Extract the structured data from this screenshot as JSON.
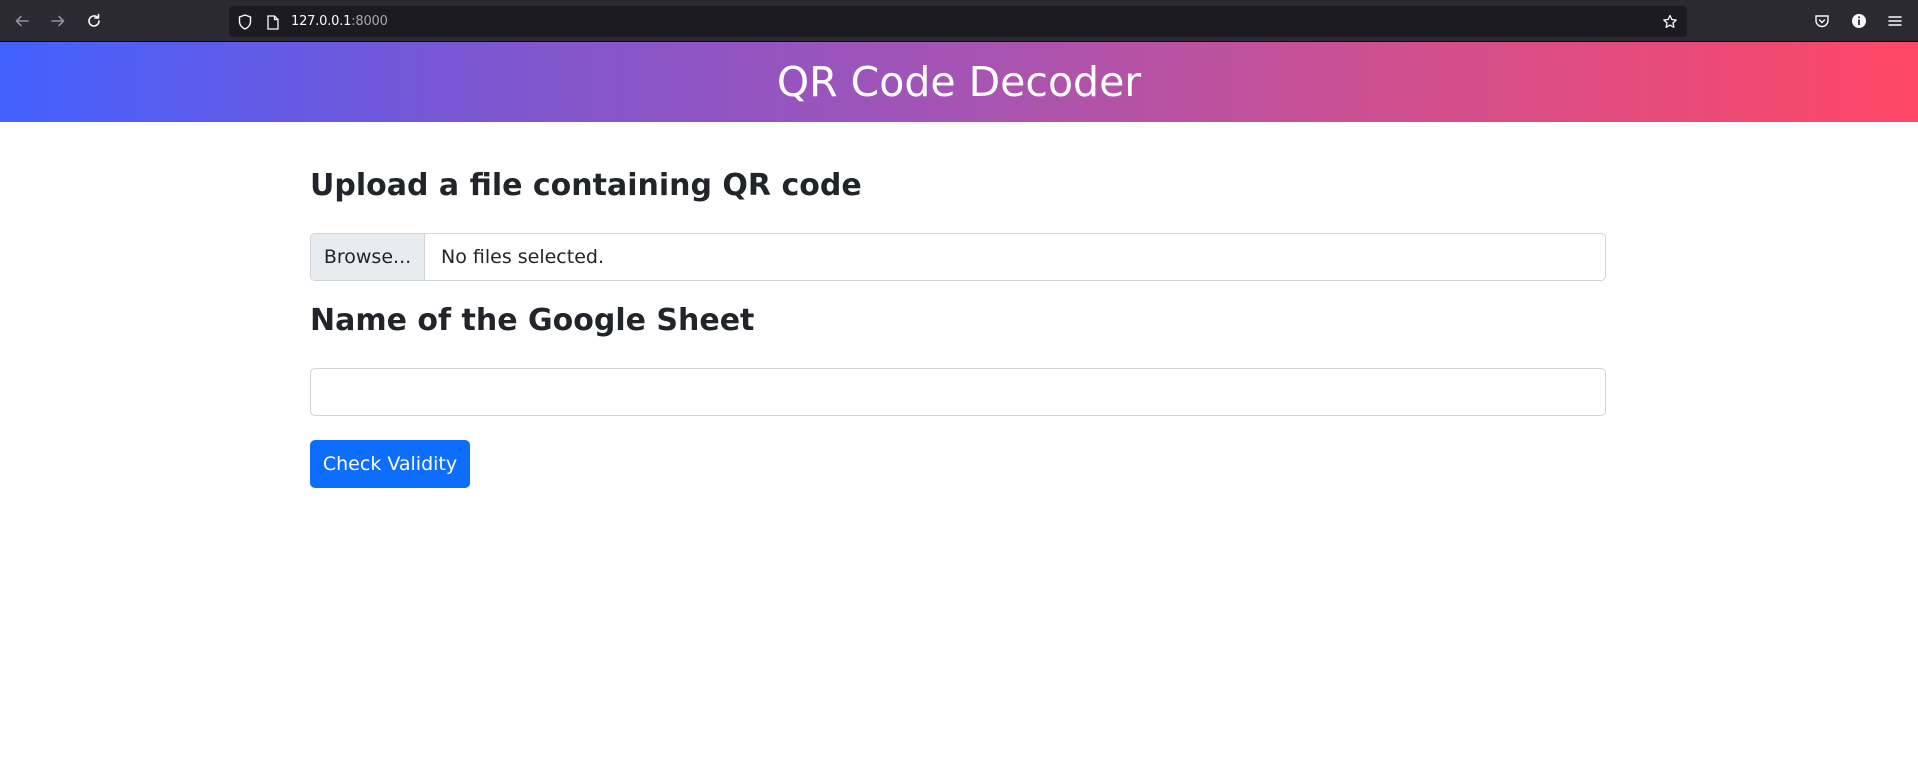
{
  "browser": {
    "url_host": "127.0.0.1",
    "url_port": ":8000",
    "icons": [
      "back-icon",
      "forward-icon",
      "reload-icon",
      "shield-icon",
      "page-icon",
      "star-icon",
      "pocket-icon",
      "info-icon",
      "menu-icon"
    ]
  },
  "header": {
    "title": "QR Code Decoder"
  },
  "form": {
    "upload_heading": "Upload a file containing QR code",
    "browse_label": "Browse...",
    "file_status": "No files selected.",
    "sheet_heading": "Name of the Google Sheet",
    "sheet_value": "",
    "submit_label": "Check Validity"
  },
  "colors": {
    "primary": "#0d6efd",
    "banner_start": "#4361ff",
    "banner_end": "#ff4766"
  }
}
